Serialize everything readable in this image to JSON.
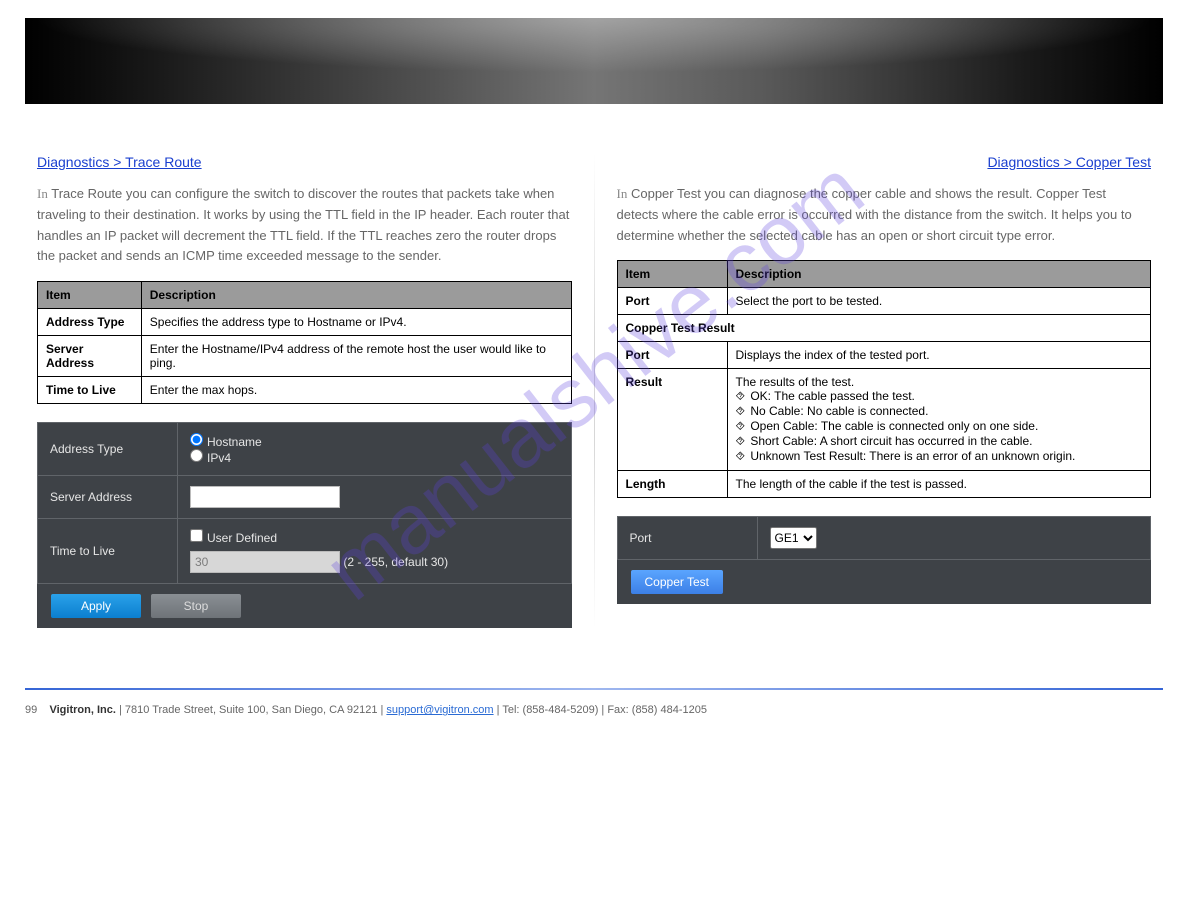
{
  "watermark": "manualshive.com",
  "header_brand": "",
  "header_slogan": "",
  "left": {
    "nav": "Diagnostics > Trace Route",
    "p1_in": "In",
    "p1": "Trace Route you can configure the switch to discover the routes that packets take when traveling to their destination. It works by using the TTL field in the IP header. Each router that handles an IP packet will decrement the TTL field. If the TTL reaches zero the router drops the packet and sends an ICMP time exceeded message to the sender.",
    "table": {
      "h1": "Item",
      "h2": "Description",
      "r1a": "Address Type",
      "r1b": "Specifies the address type to Hostname or IPv4.",
      "r2a": "Server Address",
      "r2b": "Enter the Hostname/IPv4 address of the remote host the user would like to ping.",
      "r3a": "Time to Live",
      "r3b": "Enter the max hops."
    },
    "panel": {
      "addr_type": "Address Type",
      "opt_host": "Hostname",
      "opt_ipv4": "IPv4",
      "server": "Server Address",
      "ttl": "Time to Live",
      "ud": "User Defined",
      "ttl_val": "30",
      "ttl_hint": "(2 - 255, default 30)",
      "apply": "Apply",
      "stop": "Stop"
    }
  },
  "right": {
    "nav": "Diagnostics > Copper Test",
    "p1_in": "In",
    "p1": "Copper Test you can diagnose the copper cable and shows the result. Copper Test detects where the cable error is occurred with the distance from the switch. It helps you to determine whether the selected cable has an open or short circuit type error.",
    "table": {
      "h1": "Item",
      "h2": "Description",
      "r1a": "Port",
      "r1b": "Select the port to be tested.",
      "sec": "Copper Test Result",
      "r2a": "Port",
      "r2b": "Displays the index of the tested port.",
      "r3a": "Result",
      "r3b1": "The results of the test.",
      "r3b2": "OK: The cable passed the test.",
      "r3b3": "No Cable: No cable is connected.",
      "r3b4": "Open Cable: The cable is connected only on one side.",
      "r3b5": "Short Cable: A short circuit has occurred in the cable.",
      "r3b6": "Unknown Test Result: There is an error of an unknown origin.",
      "rg": "⯑",
      "r4a": "Length",
      "r4b": "The length of the cable if the test is passed."
    },
    "panel": {
      "port": "Port",
      "sel": "GE1",
      "btn": "Copper Test"
    }
  },
  "footer": {
    "page": "99",
    "brand": "Vigitron, Inc.",
    "addr": "| 7810 Trade Street, Suite 100, San Diego, CA 92121 | ",
    "email": "support@vigitron.com",
    "tel": " | Tel: (858-484-5209) | Fax: (858) 484-1205 "
  }
}
